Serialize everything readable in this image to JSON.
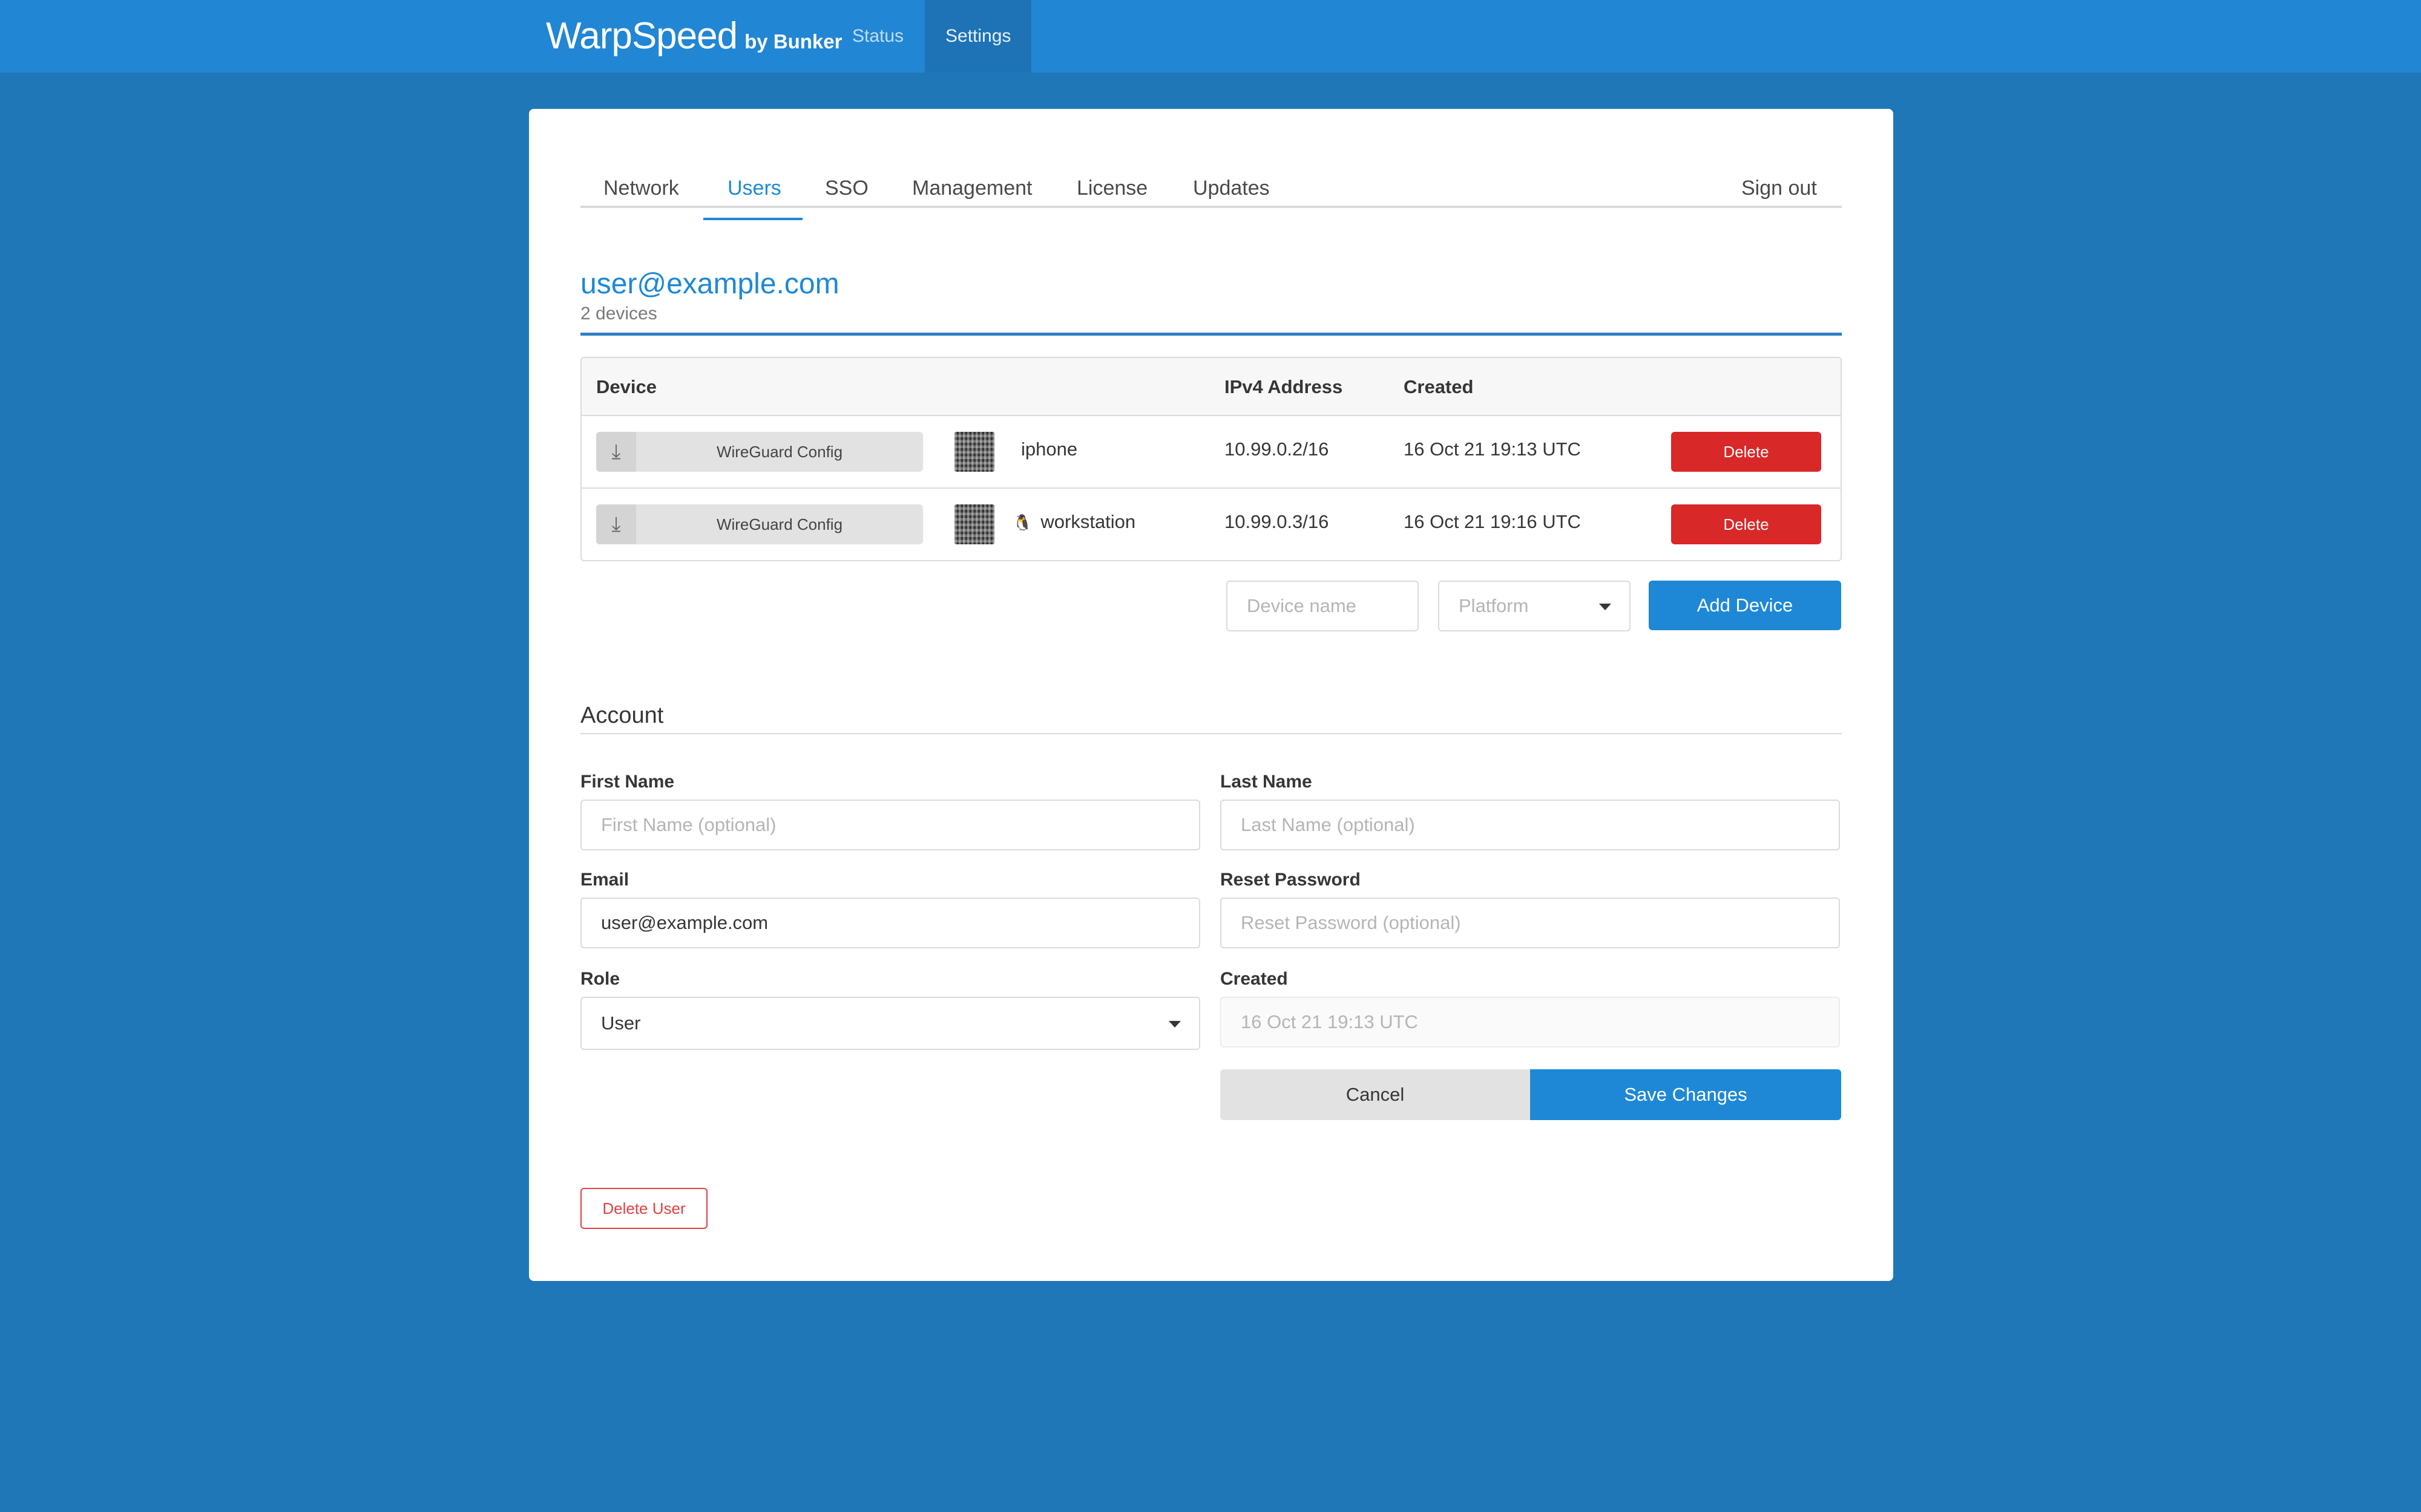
{
  "navbar": {
    "brand": "WarpSpeed",
    "brand_sub": "by Bunker",
    "items": [
      {
        "label": "Status",
        "active": false
      },
      {
        "label": "Settings",
        "active": true
      }
    ]
  },
  "tabs": [
    {
      "label": "Network",
      "active": false
    },
    {
      "label": "Users",
      "active": true
    },
    {
      "label": "SSO",
      "active": false
    },
    {
      "label": "Management",
      "active": false
    },
    {
      "label": "License",
      "active": false
    },
    {
      "label": "Updates",
      "active": false
    }
  ],
  "sign_out": "Sign out",
  "user": {
    "email": "user@example.com",
    "device_count": "2 devices"
  },
  "devices_table": {
    "columns": [
      "Device",
      "IPv4 Address",
      "Created"
    ],
    "config_button_label": "WireGuard Config",
    "delete_label": "Delete",
    "rows": [
      {
        "name": "iphone",
        "platform_icon": "apple-icon",
        "ip": "10.99.0.2/16",
        "created": "16 Oct 21 19:13 UTC"
      },
      {
        "name": "workstation",
        "platform_icon": "linux-icon",
        "ip": "10.99.0.3/16",
        "created": "16 Oct 21 19:16 UTC"
      }
    ]
  },
  "add_device": {
    "name_placeholder": "Device name",
    "platform_placeholder": "Platform",
    "button_label": "Add Device"
  },
  "account": {
    "title": "Account",
    "first_name": {
      "label": "First Name",
      "placeholder": "First Name (optional)",
      "value": ""
    },
    "last_name": {
      "label": "Last Name",
      "placeholder": "Last Name (optional)",
      "value": ""
    },
    "email": {
      "label": "Email",
      "value": "user@example.com"
    },
    "reset_password": {
      "label": "Reset Password",
      "placeholder": "Reset Password (optional)"
    },
    "role": {
      "label": "Role",
      "value": "User"
    },
    "created": {
      "label": "Created",
      "value": "16 Oct 21 19:13 UTC"
    },
    "cancel_label": "Cancel",
    "save_label": "Save Changes",
    "delete_user_label": "Delete User"
  },
  "colors": {
    "page_bg": "#1f77b8",
    "navbar_bg": "#2186d4",
    "accent": "#1e88d6",
    "danger": "#d92828"
  }
}
